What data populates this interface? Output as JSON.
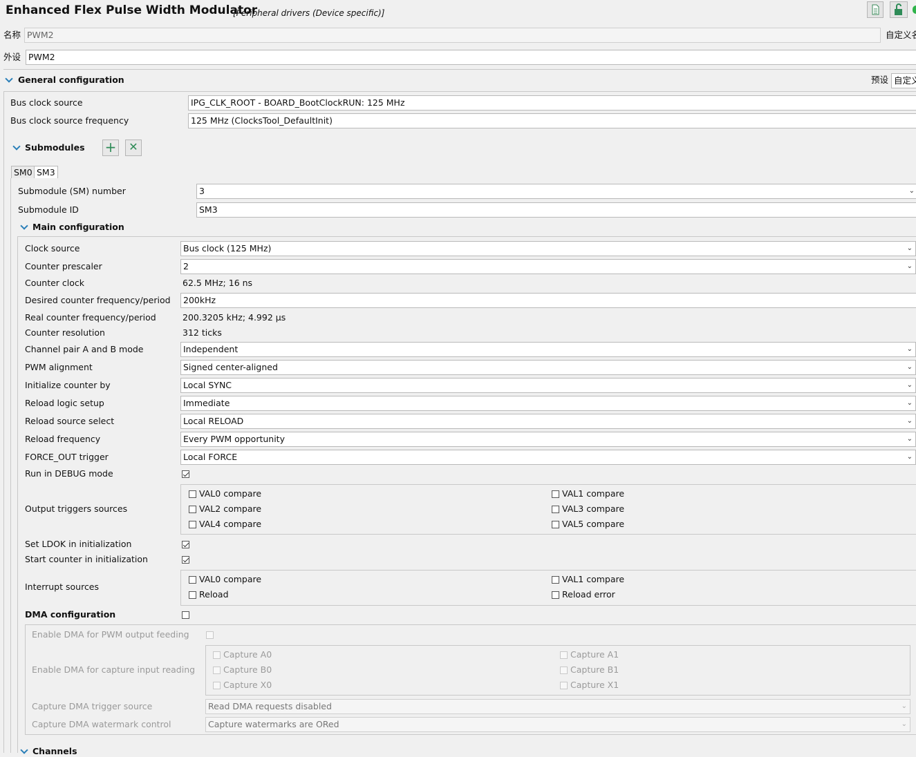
{
  "header": {
    "title": "Enhanced Flex Pulse Width Modulator",
    "subtitle": "[Peripheral drivers (Device specific)]",
    "name_label": "名称",
    "name_value": "PWM2",
    "custom_name_label": "自定义名",
    "peripheral_label": "外设",
    "peripheral_value": "PWM2"
  },
  "general": {
    "title": "General configuration",
    "preset_label": "预设",
    "preset_value": "自定义",
    "bus_clock_source_label": "Bus clock source",
    "bus_clock_source_value": "IPG_CLK_ROOT - BOARD_BootClockRUN: 125 MHz",
    "bus_clock_freq_label": "Bus clock source frequency",
    "bus_clock_freq_value": "125 MHz (ClocksTool_DefaultInit)"
  },
  "submodules": {
    "title": "Submodules",
    "tabs": [
      "SM0",
      "SM3"
    ],
    "active_tab": "SM3",
    "sm_number_label": "Submodule (SM) number",
    "sm_number_value": "3",
    "sm_id_label": "Submodule ID",
    "sm_id_value": "SM3"
  },
  "main": {
    "title": "Main configuration",
    "rows": [
      {
        "label": "Clock source",
        "value": "Bus clock (125 MHz)"
      },
      {
        "label": "Counter prescaler",
        "value": "2"
      },
      {
        "label": "Counter clock",
        "value": "62.5 MHz; 16 ns"
      },
      {
        "label": "Desired counter frequency/period",
        "value": "200kHz"
      },
      {
        "label": "Real counter frequency/period",
        "value": "200.3205 kHz; 4.992 µs"
      },
      {
        "label": "Counter resolution",
        "value": "312 ticks"
      },
      {
        "label": "Channel pair A and B mode",
        "value": "Independent"
      },
      {
        "label": "PWM alignment",
        "value": "Signed center-aligned"
      },
      {
        "label": "Initialize counter by",
        "value": "Local SYNC"
      },
      {
        "label": "Reload logic setup",
        "value": "Immediate"
      },
      {
        "label": "Reload source select",
        "value": "Local RELOAD"
      },
      {
        "label": "Reload frequency",
        "value": "Every PWM opportunity"
      },
      {
        "label": "FORCE_OUT trigger",
        "value": "Local FORCE"
      }
    ],
    "run_debug_label": "Run in DEBUG mode",
    "run_debug_checked": true,
    "output_triggers_label": "Output triggers sources",
    "output_triggers": [
      "VAL0 compare",
      "VAL1 compare",
      "VAL2 compare",
      "VAL3 compare",
      "VAL4 compare",
      "VAL5 compare"
    ],
    "set_ldok_label": "Set LDOK in initialization",
    "set_ldok_checked": true,
    "start_counter_label": "Start counter in initialization",
    "start_counter_checked": true,
    "interrupt_label": "Interrupt sources",
    "interrupts": [
      "VAL0 compare",
      "VAL1 compare",
      "Reload",
      "Reload error"
    ]
  },
  "dma": {
    "title": "DMA configuration",
    "enabled": false,
    "output_feeding_label": "Enable DMA for PWM output feeding",
    "capture_reading_label": "Enable DMA for capture input reading",
    "captures": [
      "Capture A0",
      "Capture A1",
      "Capture B0",
      "Capture B1",
      "Capture X0",
      "Capture X1"
    ],
    "trigger_source_label": "Capture DMA trigger source",
    "trigger_source_value": "Read DMA requests disabled",
    "watermark_label": "Capture DMA watermark control",
    "watermark_value": "Capture watermarks are ORed"
  },
  "channels": {
    "title": "Channels"
  },
  "icons": {
    "doc": "document-icon",
    "lock": "unlock-icon",
    "status": "status-dot-icon",
    "add": "plus-icon",
    "remove": "x-icon"
  }
}
